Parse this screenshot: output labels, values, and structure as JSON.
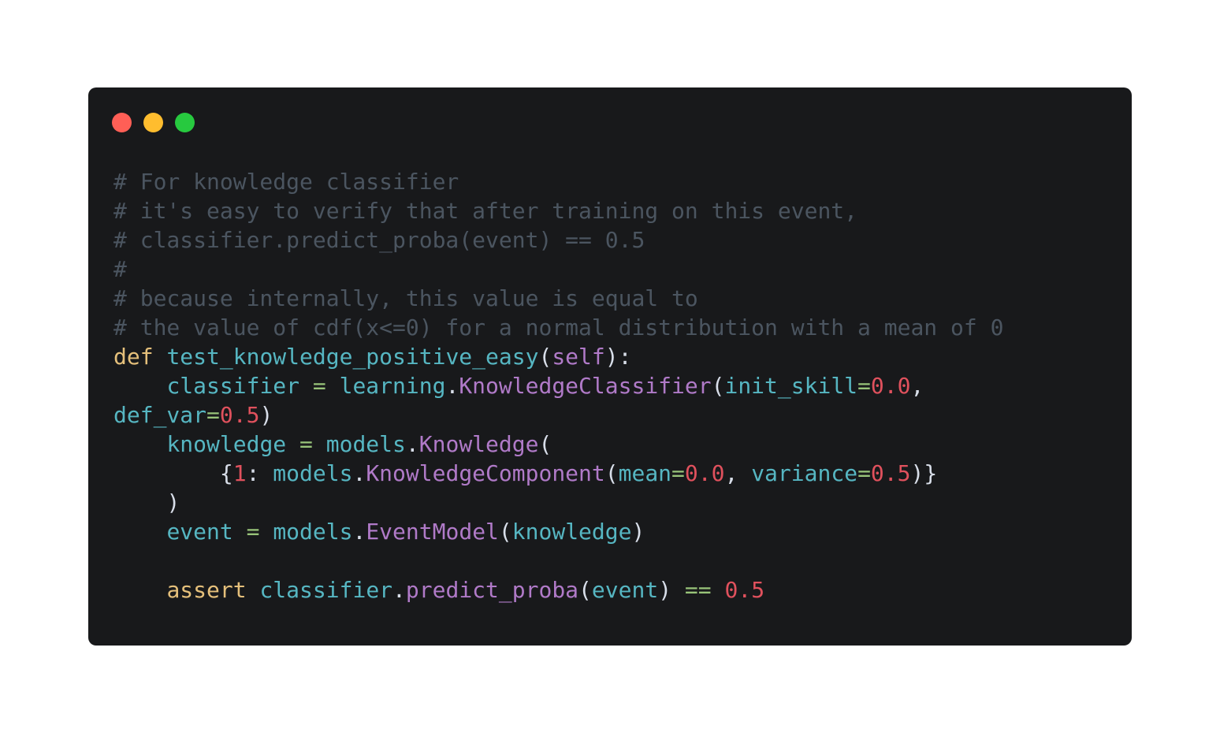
{
  "window": {
    "controls": [
      "close",
      "minimize",
      "maximize"
    ]
  },
  "colors": {
    "background": "#18191b",
    "comment": "#4b5560",
    "keyword": "#e5c07b",
    "identifier": "#56b6c2",
    "class": "#b07ac8",
    "number": "#e0515d",
    "operator": "#98c379",
    "punctuation": "#d8dee9"
  },
  "code": {
    "lines": [
      [
        {
          "t": "comment",
          "v": "# For knowledge classifier"
        }
      ],
      [
        {
          "t": "comment",
          "v": "# it's easy to verify that after training on this event,"
        }
      ],
      [
        {
          "t": "comment",
          "v": "# classifier.predict_proba(event) == 0.5"
        }
      ],
      [
        {
          "t": "comment",
          "v": "#"
        }
      ],
      [
        {
          "t": "comment",
          "v": "# because internally, this value is equal to"
        }
      ],
      [
        {
          "t": "comment",
          "v": "# the value of cdf(x<=0) for a normal distribution with a mean of 0"
        }
      ],
      [
        {
          "t": "keyword",
          "v": "def"
        },
        {
          "t": "space",
          "v": " "
        },
        {
          "t": "ident",
          "v": "test_knowledge_positive_easy"
        },
        {
          "t": "punct",
          "v": "("
        },
        {
          "t": "self",
          "v": "self"
        },
        {
          "t": "punct",
          "v": "):"
        }
      ],
      [
        {
          "t": "space",
          "v": "    "
        },
        {
          "t": "ident",
          "v": "classifier"
        },
        {
          "t": "space",
          "v": " "
        },
        {
          "t": "op",
          "v": "="
        },
        {
          "t": "space",
          "v": " "
        },
        {
          "t": "ident",
          "v": "learning"
        },
        {
          "t": "punct",
          "v": "."
        },
        {
          "t": "class",
          "v": "KnowledgeClassifier"
        },
        {
          "t": "punct",
          "v": "("
        },
        {
          "t": "ident",
          "v": "init_skill"
        },
        {
          "t": "op",
          "v": "="
        },
        {
          "t": "number",
          "v": "0.0"
        },
        {
          "t": "punct",
          "v": ","
        }
      ],
      [
        {
          "t": "ident",
          "v": "def_var"
        },
        {
          "t": "op",
          "v": "="
        },
        {
          "t": "number",
          "v": "0.5"
        },
        {
          "t": "punct",
          "v": ")"
        }
      ],
      [
        {
          "t": "space",
          "v": "    "
        },
        {
          "t": "ident",
          "v": "knowledge"
        },
        {
          "t": "space",
          "v": " "
        },
        {
          "t": "op",
          "v": "="
        },
        {
          "t": "space",
          "v": " "
        },
        {
          "t": "ident",
          "v": "models"
        },
        {
          "t": "punct",
          "v": "."
        },
        {
          "t": "class",
          "v": "Knowledge"
        },
        {
          "t": "punct",
          "v": "("
        }
      ],
      [
        {
          "t": "space",
          "v": "        "
        },
        {
          "t": "punct",
          "v": "{"
        },
        {
          "t": "number",
          "v": "1"
        },
        {
          "t": "punct",
          "v": ":"
        },
        {
          "t": "space",
          "v": " "
        },
        {
          "t": "ident",
          "v": "models"
        },
        {
          "t": "punct",
          "v": "."
        },
        {
          "t": "class",
          "v": "KnowledgeComponent"
        },
        {
          "t": "punct",
          "v": "("
        },
        {
          "t": "ident",
          "v": "mean"
        },
        {
          "t": "op",
          "v": "="
        },
        {
          "t": "number",
          "v": "0.0"
        },
        {
          "t": "punct",
          "v": ","
        },
        {
          "t": "space",
          "v": " "
        },
        {
          "t": "ident",
          "v": "variance"
        },
        {
          "t": "op",
          "v": "="
        },
        {
          "t": "number",
          "v": "0.5"
        },
        {
          "t": "punct",
          "v": ")}"
        }
      ],
      [
        {
          "t": "space",
          "v": "    "
        },
        {
          "t": "punct",
          "v": ")"
        }
      ],
      [
        {
          "t": "space",
          "v": "    "
        },
        {
          "t": "ident",
          "v": "event"
        },
        {
          "t": "space",
          "v": " "
        },
        {
          "t": "op",
          "v": "="
        },
        {
          "t": "space",
          "v": " "
        },
        {
          "t": "ident",
          "v": "models"
        },
        {
          "t": "punct",
          "v": "."
        },
        {
          "t": "class",
          "v": "EventModel"
        },
        {
          "t": "punct",
          "v": "("
        },
        {
          "t": "ident",
          "v": "knowledge"
        },
        {
          "t": "punct",
          "v": ")"
        }
      ],
      [],
      [
        {
          "t": "space",
          "v": "    "
        },
        {
          "t": "keyword",
          "v": "assert"
        },
        {
          "t": "space",
          "v": " "
        },
        {
          "t": "ident",
          "v": "classifier"
        },
        {
          "t": "punct",
          "v": "."
        },
        {
          "t": "class",
          "v": "predict_proba"
        },
        {
          "t": "punct",
          "v": "("
        },
        {
          "t": "ident",
          "v": "event"
        },
        {
          "t": "punct",
          "v": ")"
        },
        {
          "t": "space",
          "v": " "
        },
        {
          "t": "op",
          "v": "=="
        },
        {
          "t": "space",
          "v": " "
        },
        {
          "t": "number",
          "v": "0.5"
        }
      ]
    ]
  }
}
